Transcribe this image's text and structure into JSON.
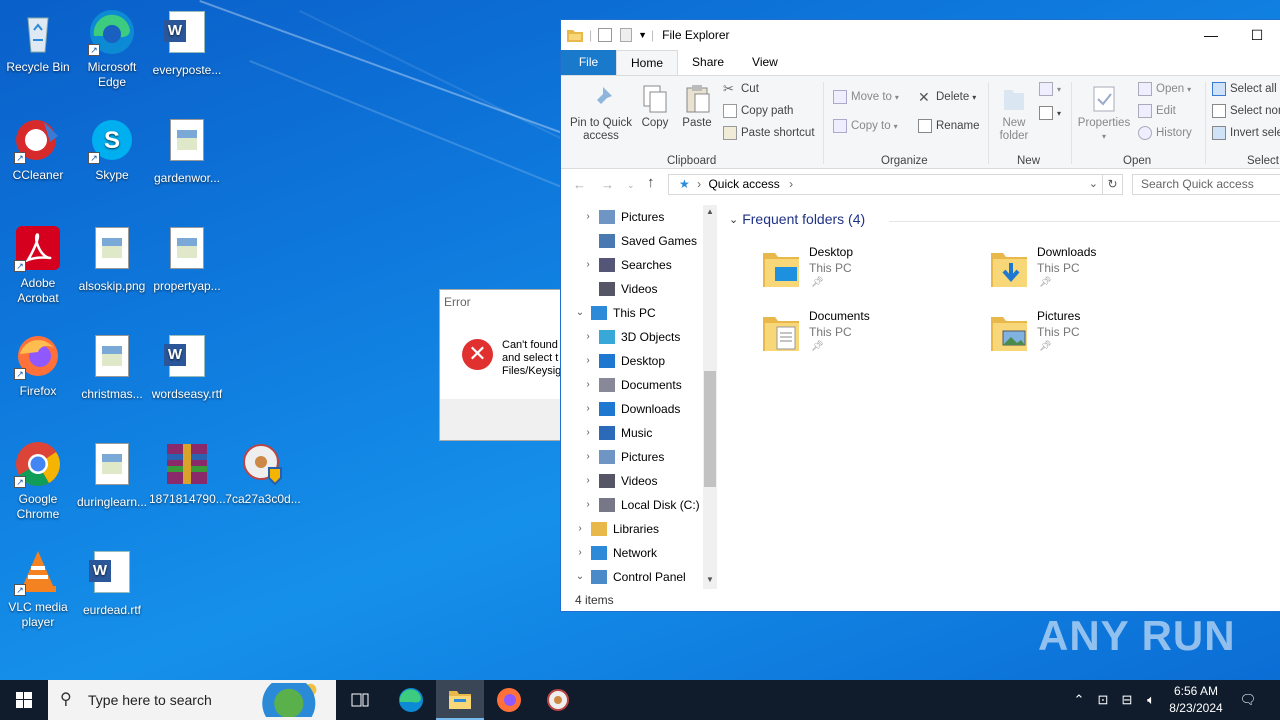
{
  "desktop": {
    "icons": [
      {
        "label": "Recycle Bin",
        "icon": "recycle-bin-icon"
      },
      {
        "label": "Microsoft Edge",
        "icon": "edge-icon"
      },
      {
        "label": "everyposte...",
        "icon": "word-document-icon"
      },
      {
        "label": "CCleaner",
        "icon": "ccleaner-icon"
      },
      {
        "label": "Skype",
        "icon": "skype-icon"
      },
      {
        "label": "gardenwor...",
        "icon": "image-file-icon"
      },
      {
        "label": "Adobe Acrobat",
        "icon": "acrobat-icon"
      },
      {
        "label": "alsoskip.png",
        "icon": "image-file-icon"
      },
      {
        "label": "propertyap...",
        "icon": "image-file-icon"
      },
      {
        "label": "Firefox",
        "icon": "firefox-icon"
      },
      {
        "label": "christmas...",
        "icon": "image-file-icon"
      },
      {
        "label": "wordseasy.rtf",
        "icon": "word-document-icon"
      },
      {
        "label": "Google Chrome",
        "icon": "chrome-icon"
      },
      {
        "label": "duringlearn...",
        "icon": "image-file-icon"
      },
      {
        "label": "1871814790...",
        "icon": "winrar-archive-icon"
      },
      {
        "label": "7ca27a3c0d...",
        "icon": "installer-icon"
      },
      {
        "label": "VLC media player",
        "icon": "vlc-icon"
      },
      {
        "label": "eurdead.rtf",
        "icon": "word-document-icon"
      }
    ]
  },
  "error_dialog": {
    "title": "Error",
    "message_line1": "Can't found",
    "message_line2": "and select t",
    "message_line3": "Files/Keysig"
  },
  "explorer": {
    "title": "File Explorer",
    "tabs": [
      "File",
      "Home",
      "Share",
      "View"
    ],
    "ribbon": {
      "clipboard": {
        "pin": "Pin to Quick access",
        "copy": "Copy",
        "paste": "Paste",
        "cut": "Cut",
        "copy_path": "Copy path",
        "paste_shortcut": "Paste shortcut",
        "group": "Clipboard"
      },
      "organize": {
        "move_to": "Move to",
        "copy_to": "Copy to",
        "delete": "Delete",
        "rename": "Rename",
        "group": "Organize"
      },
      "new": {
        "new_folder": "New folder",
        "group": "New"
      },
      "open": {
        "properties": "Properties",
        "open": "Open",
        "edit": "Edit",
        "history": "History",
        "group": "Open"
      },
      "select": {
        "select_all": "Select all",
        "select_none": "Select none",
        "invert": "Invert selection",
        "group": "Select"
      }
    },
    "address": {
      "path": "Quick access",
      "search_placeholder": "Search Quick access"
    },
    "nav_items": [
      {
        "label": "Pictures",
        "indent": 2,
        "expander": "›",
        "icon": "pictures-icon"
      },
      {
        "label": "Saved Games",
        "indent": 2,
        "expander": "",
        "icon": "saved-games-icon"
      },
      {
        "label": "Searches",
        "indent": 2,
        "expander": "›",
        "icon": "searches-icon"
      },
      {
        "label": "Videos",
        "indent": 2,
        "expander": "",
        "icon": "videos-icon"
      },
      {
        "label": "This PC",
        "indent": 1,
        "expander": "⌄",
        "icon": "this-pc-icon"
      },
      {
        "label": "3D Objects",
        "indent": 2,
        "expander": "›",
        "icon": "3d-objects-icon"
      },
      {
        "label": "Desktop",
        "indent": 2,
        "expander": "›",
        "icon": "desktop-icon"
      },
      {
        "label": "Documents",
        "indent": 2,
        "expander": "›",
        "icon": "documents-icon"
      },
      {
        "label": "Downloads",
        "indent": 2,
        "expander": "›",
        "icon": "downloads-icon"
      },
      {
        "label": "Music",
        "indent": 2,
        "expander": "›",
        "icon": "music-icon"
      },
      {
        "label": "Pictures",
        "indent": 2,
        "expander": "›",
        "icon": "pictures-icon"
      },
      {
        "label": "Videos",
        "indent": 2,
        "expander": "›",
        "icon": "videos-icon"
      },
      {
        "label": "Local Disk (C:)",
        "indent": 2,
        "expander": "›",
        "icon": "local-disk-icon"
      },
      {
        "label": "Libraries",
        "indent": 1,
        "expander": "›",
        "icon": "libraries-icon"
      },
      {
        "label": "Network",
        "indent": 1,
        "expander": "›",
        "icon": "network-icon"
      },
      {
        "label": "Control Panel",
        "indent": 1,
        "expander": "⌄",
        "icon": "control-panel-icon"
      }
    ],
    "frequent_header": "Frequent folders (4)",
    "folders": [
      {
        "name": "Desktop",
        "location": "This PC",
        "icon": "desktop-folder-icon"
      },
      {
        "name": "Downloads",
        "location": "This PC",
        "icon": "downloads-folder-icon"
      },
      {
        "name": "Documents",
        "location": "This PC",
        "icon": "documents-folder-icon"
      },
      {
        "name": "Pictures",
        "location": "This PC",
        "icon": "pictures-folder-icon"
      }
    ],
    "status": "4 items"
  },
  "taskbar": {
    "search_placeholder": "Type here to search",
    "time": "6:56 AM",
    "date": "8/23/2024"
  },
  "watermark": "ANY RUN",
  "colors": {
    "accent": "#1979ca",
    "taskbar": "#101c2b",
    "error": "#e0302f"
  }
}
